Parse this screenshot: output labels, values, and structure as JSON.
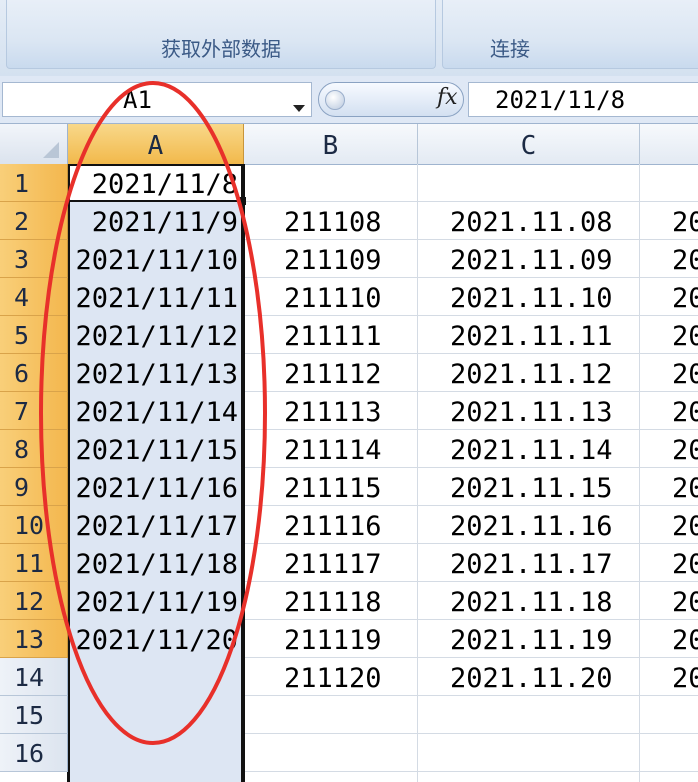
{
  "ribbon": {
    "groups": [
      {
        "label": "获取外部数据"
      },
      {
        "label": "连接"
      }
    ]
  },
  "formula_bar": {
    "name_box": "A1",
    "fx_label": "fx",
    "formula": "2021/11/8"
  },
  "columns": [
    {
      "label": "A"
    },
    {
      "label": "B"
    },
    {
      "label": "C"
    }
  ],
  "rows": [
    "1",
    "2",
    "3",
    "4",
    "5",
    "6",
    "7",
    "8",
    "9",
    "10",
    "11",
    "12",
    "13",
    "14",
    "15",
    "16"
  ],
  "cells": {
    "A": [
      "2021/11/8",
      "2021/11/9",
      "2021/11/10",
      "2021/11/11",
      "2021/11/12",
      "2021/11/13",
      "2021/11/14",
      "2021/11/15",
      "2021/11/16",
      "2021/11/17",
      "2021/11/18",
      "2021/11/19",
      "2021/11/20"
    ],
    "B": [
      "211108",
      "211109",
      "211110",
      "211111",
      "211112",
      "211113",
      "211114",
      "211115",
      "211116",
      "211117",
      "211118",
      "211119",
      "211120"
    ],
    "C": [
      "2021.11.08",
      "2021.11.09",
      "2021.11.10",
      "2021.11.11",
      "2021.11.12",
      "2021.11.13",
      "2021.11.14",
      "2021.11.15",
      "2021.11.16",
      "2021.11.17",
      "2021.11.18",
      "2021.11.19",
      "2021.11.20"
    ],
    "D_partial": [
      "20",
      "20",
      "20",
      "20",
      "20",
      "20",
      "20",
      "20",
      "20",
      "20",
      "20",
      "20",
      "20"
    ]
  },
  "colors": {
    "accent_selection": "#f3b74e",
    "annotation": "#e8302a"
  }
}
